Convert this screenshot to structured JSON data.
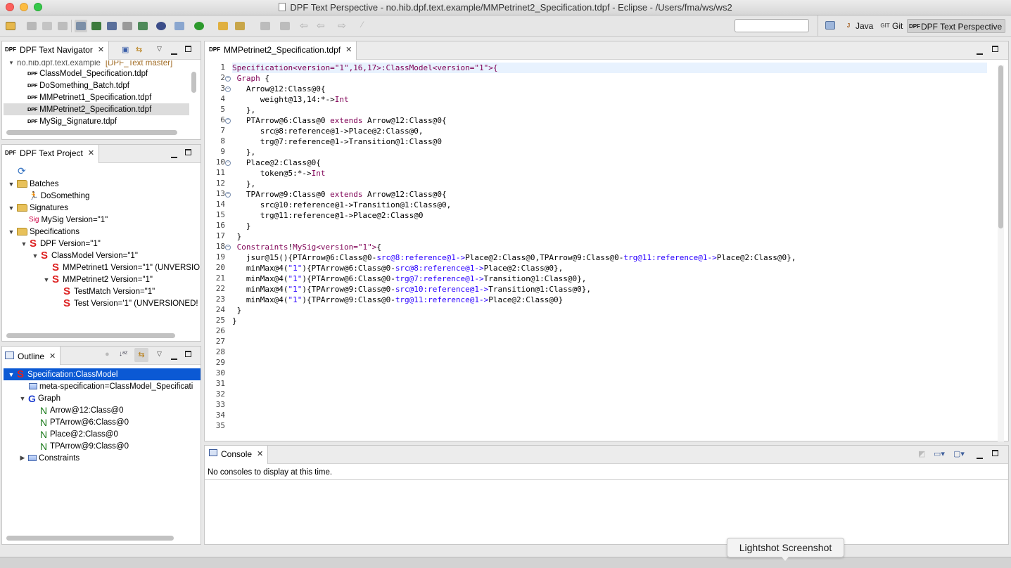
{
  "window": {
    "title": "DPF Text Perspective - no.hib.dpf.text.example/MMPetrinet2_Specification.tdpf - Eclipse - /Users/fma/ws/ws2"
  },
  "toolbar": {
    "search_value": "",
    "perspectives": [
      {
        "label": "Java",
        "icon": "java-perspective-icon"
      },
      {
        "label": "Git",
        "icon": "git-perspective-icon"
      },
      {
        "label": "DPF Text Perspective",
        "icon": "dpf-perspective-icon",
        "active": true
      }
    ]
  },
  "navigator": {
    "tab_label": "DPF Text Navigator",
    "project_label": "no.hib.dpf.text.example",
    "project_suffix": "[DPF_Text master]",
    "files": [
      "ClassModel_Specification.tdpf",
      "DoSomething_Batch.tdpf",
      "MMPetrinet1_Specification.tdpf",
      "MMPetrinet2_Specification.tdpf",
      "MySig_Signature.tdpf"
    ],
    "selected_index": 3,
    "file_icon": "DPF"
  },
  "project_view": {
    "tab_label": "DPF Text Project",
    "batches_label": "Batches",
    "batch_item": "DoSomething",
    "signatures_label": "Signatures",
    "sig_icon": "Sig",
    "sig_item": "MySig Version=\"1\"",
    "specifications_label": "Specifications",
    "specs": [
      {
        "label": "DPF Version=\"1\"",
        "level": 1
      },
      {
        "label": "ClassModel Version=\"1\"",
        "level": 2
      },
      {
        "label": "MMPetrinet1 Version=\"1\" (UNVERSIO",
        "level": 3
      },
      {
        "label": "MMPetrinet2 Version=\"1\"",
        "level": 3
      },
      {
        "label": "TestMatch Version=\"1\"",
        "level": 4
      },
      {
        "label": "Test Version='1\" (UNVERSIONED!",
        "level": 4
      }
    ]
  },
  "outline": {
    "tab_label": "Outline",
    "root": "Specification:ClassModel",
    "meta": "meta-specification=ClassModel_Specificati",
    "graph": "Graph",
    "nodes": [
      "Arrow@12:Class@0",
      "PTArrow@6:Class@0",
      "Place@2:Class@0",
      "TPArrow@9:Class@0"
    ],
    "constraints": "Constraints"
  },
  "editor": {
    "tab_label": "MMPetrinet2_Specification.tdpf",
    "fold_lines": [
      2,
      3,
      6,
      10,
      13,
      18
    ],
    "line_count": 35,
    "lines": [
      [
        [
          "p",
          "Specification<version=\"1\",16,17>:ClassModel<version=\"1\">{"
        ]
      ],
      [
        [
          "k",
          " Graph "
        ],
        [
          "n",
          "{"
        ]
      ],
      [
        [
          "n",
          "   Arrow@12:Class@0{"
        ]
      ],
      [
        [
          "n",
          "      weight@13,14:*->"
        ],
        [
          "k",
          "Int"
        ]
      ],
      [
        [
          "n",
          "   },"
        ]
      ],
      [
        [
          "n",
          "   PTArrow@6:Class@0 "
        ],
        [
          "k",
          "extends"
        ],
        [
          "n",
          " Arrow@12:Class@0{"
        ]
      ],
      [
        [
          "n",
          "      src@8:reference@1->Place@2:Class@0,"
        ]
      ],
      [
        [
          "n",
          "      trg@7:reference@1->Transition@1:Class@0"
        ]
      ],
      [
        [
          "n",
          "   },"
        ]
      ],
      [
        [
          "n",
          "   Place@2:Class@0{"
        ]
      ],
      [
        [
          "n",
          "      token@5:*->"
        ],
        [
          "k",
          "Int"
        ]
      ],
      [
        [
          "n",
          "   },"
        ]
      ],
      [
        [
          "n",
          "   TPArrow@9:Class@0 "
        ],
        [
          "k",
          "extends"
        ],
        [
          "n",
          " Arrow@12:Class@0{"
        ]
      ],
      [
        [
          "n",
          "      src@10:reference@1->Transition@1:Class@0,"
        ]
      ],
      [
        [
          "n",
          "      trg@11:reference@1->Place@2:Class@0"
        ]
      ],
      [
        [
          "n",
          "   }"
        ]
      ],
      [
        [
          "n",
          " }"
        ]
      ],
      [
        [
          "k",
          " Constraints"
        ],
        [
          "n",
          "!"
        ],
        [
          "p",
          "MySig<version=\"1\">"
        ],
        [
          "n",
          "{"
        ]
      ],
      [
        [
          "n",
          "   jsur@15(){PTArrow@6:Class@0-"
        ],
        [
          "b",
          "src@8:reference@1->"
        ],
        [
          "n",
          "Place@2:Class@0,TPArrow@9:Class@0-"
        ],
        [
          "b",
          "trg@11:reference@1->"
        ],
        [
          "n",
          "Place@2:Class@0},"
        ]
      ],
      [
        [
          "n",
          "   minMax@4("
        ],
        [
          "b",
          "\"1\""
        ],
        [
          "n",
          "){PTArrow@6:Class@0-"
        ],
        [
          "b",
          "src@8:reference@1->"
        ],
        [
          "n",
          "Place@2:Class@0},"
        ]
      ],
      [
        [
          "n",
          "   minMax@4("
        ],
        [
          "b",
          "\"1\""
        ],
        [
          "n",
          "){PTArrow@6:Class@0-"
        ],
        [
          "b",
          "trg@7:reference@1->"
        ],
        [
          "n",
          "Transition@1:Class@0},"
        ]
      ],
      [
        [
          "n",
          "   minMax@4("
        ],
        [
          "b",
          "\"1\""
        ],
        [
          "n",
          "){TPArrow@9:Class@0-"
        ],
        [
          "b",
          "src@10:reference@1->"
        ],
        [
          "n",
          "Transition@1:Class@0},"
        ]
      ],
      [
        [
          "n",
          "   minMax@4("
        ],
        [
          "b",
          "\"1\""
        ],
        [
          "n",
          "){TPArrow@9:Class@0-"
        ],
        [
          "b",
          "trg@11:reference@1->"
        ],
        [
          "n",
          "Place@2:Class@0}"
        ]
      ],
      [
        [
          "n",
          " }"
        ]
      ],
      [
        [
          "n",
          "}"
        ]
      ]
    ]
  },
  "console": {
    "tab_label": "Console",
    "message": "No consoles to display at this time."
  },
  "tooltip": {
    "text": "Lightshot Screenshot"
  },
  "colors": {
    "selection": "#0b59d4",
    "keyword": "#7f0055",
    "link": "#2a00ff",
    "current_line": "#e8f2fe"
  }
}
